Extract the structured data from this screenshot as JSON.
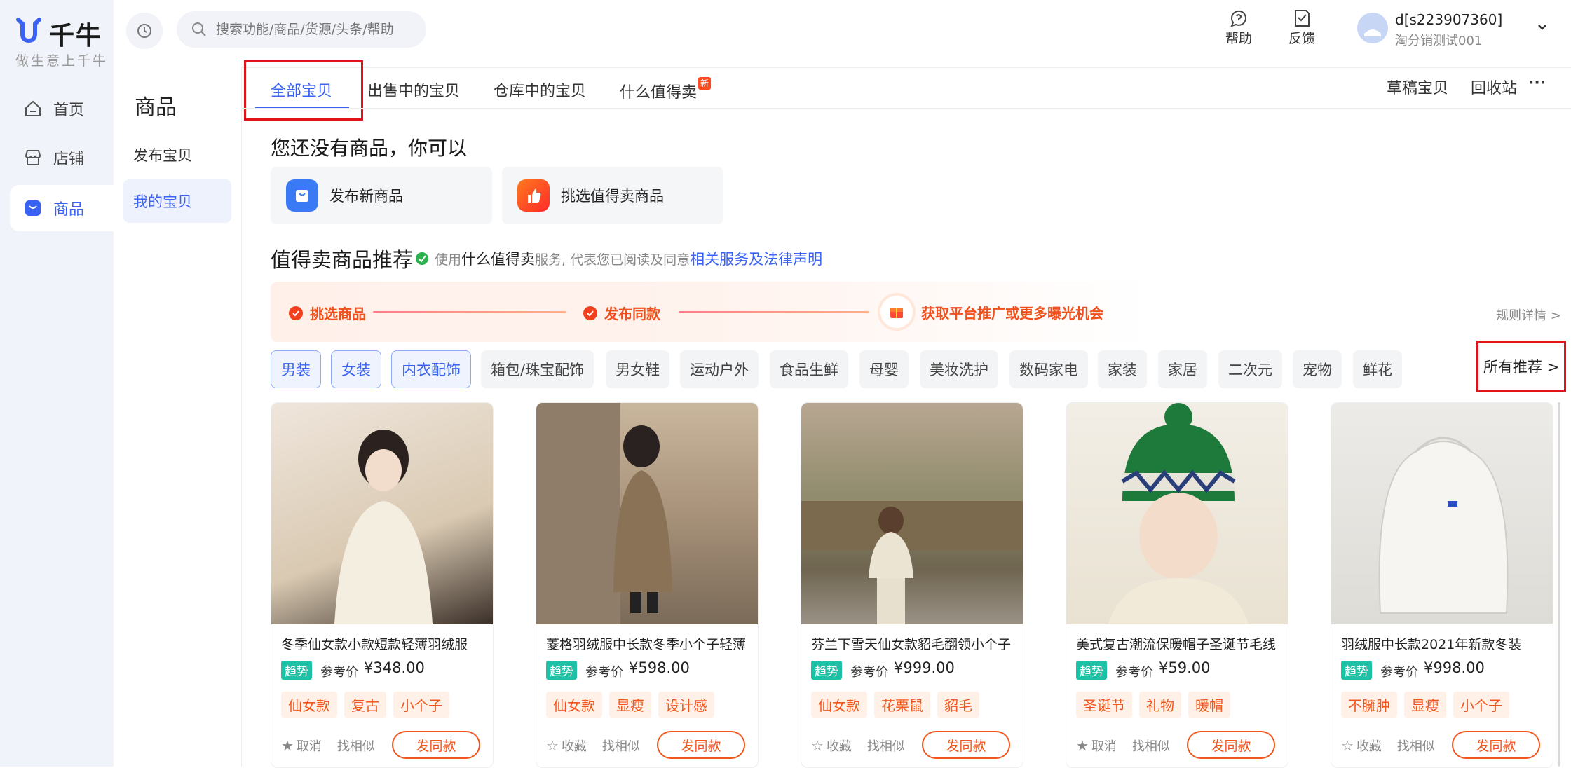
{
  "brand": {
    "name": "千牛",
    "slogan": "做生意上千牛"
  },
  "rail": [
    {
      "label": "首页",
      "icon": "home-icon"
    },
    {
      "label": "店铺",
      "icon": "store-icon"
    },
    {
      "label": "商品",
      "icon": "goods-icon",
      "active": true
    }
  ],
  "subnav": {
    "title": "商品",
    "items": [
      {
        "label": "发布宝贝"
      },
      {
        "label": "我的宝贝",
        "active": true
      }
    ]
  },
  "search": {
    "placeholder": "搜索功能/商品/货源/头条/帮助"
  },
  "tools": {
    "help": "帮助",
    "feedback": "反馈"
  },
  "user": {
    "name": "d[s223907360]",
    "sub": "淘分销测试001"
  },
  "tabs": [
    {
      "label": "全部宝贝",
      "active": true
    },
    {
      "label": "出售中的宝贝"
    },
    {
      "label": "仓库中的宝贝"
    },
    {
      "label": "什么值得卖",
      "badge": "新"
    }
  ],
  "tabs_right": {
    "draft": "草稿宝贝",
    "recycle": "回收站",
    "more": "···"
  },
  "empty": {
    "title": "您还没有商品，你可以",
    "actions": [
      {
        "label": "发布新商品"
      },
      {
        "label": "挑选值得卖商品"
      }
    ]
  },
  "section": {
    "title": "值得卖商品推荐",
    "note_prefix": "使用",
    "note_highlight": "什么值得卖",
    "note_mid": "服务, 代表您已阅读及同意",
    "note_link": "相关服务及法律声明",
    "steps": [
      "挑选商品",
      "发布同款",
      "获取平台推广或更多曝光机会"
    ],
    "rule_link": "规则详情 >"
  },
  "categories": [
    {
      "label": "男装",
      "selected": true
    },
    {
      "label": "女装",
      "selected": true
    },
    {
      "label": "内衣配饰",
      "selected": true
    },
    {
      "label": "箱包/珠宝配饰"
    },
    {
      "label": "男女鞋"
    },
    {
      "label": "运动户外"
    },
    {
      "label": "食品生鲜"
    },
    {
      "label": "母婴"
    },
    {
      "label": "美妆洗护"
    },
    {
      "label": "数码家电"
    },
    {
      "label": "家装"
    },
    {
      "label": "家居"
    },
    {
      "label": "二次元"
    },
    {
      "label": "宠物"
    },
    {
      "label": "鲜花"
    }
  ],
  "all_recommend": "所有推荐 >",
  "products": [
    {
      "name": "冬季仙女款小款短款轻薄羽绒服",
      "trend": "趋势",
      "ref": "参考价",
      "price": "¥348.00",
      "tags": [
        "仙女款",
        "复古",
        "小个子"
      ],
      "fav": "取消",
      "similar": "找相似",
      "same": "发同款",
      "colors": [
        "#efe6dc",
        "#d9c9b2"
      ]
    },
    {
      "name": "菱格羽绒服中长款冬季小个子轻薄",
      "trend": "趋势",
      "ref": "参考价",
      "price": "¥598.00",
      "tags": [
        "仙女款",
        "显瘦",
        "设计感"
      ],
      "fav": "收藏",
      "similar": "找相似",
      "same": "发同款",
      "colors": [
        "#c9b79d",
        "#8a7256"
      ]
    },
    {
      "name": "芬兰下雪天仙女款貂毛翻领小个子",
      "trend": "趋势",
      "ref": "参考价",
      "price": "¥999.00",
      "tags": [
        "仙女款",
        "花栗鼠",
        "貂毛"
      ],
      "fav": "收藏",
      "similar": "找相似",
      "same": "发同款",
      "colors": [
        "#b8a792",
        "#6f6550"
      ]
    },
    {
      "name": "美式复古潮流保暖帽子圣诞节毛线",
      "trend": "趋势",
      "ref": "参考价",
      "price": "¥59.00",
      "tags": [
        "圣诞节",
        "礼物",
        "暖帽"
      ],
      "fav": "取消",
      "similar": "找相似",
      "same": "发同款",
      "colors": [
        "#e9e2d2",
        "#1e7a3a"
      ]
    },
    {
      "name": "羽绒服中长款2021年新款冬装",
      "trend": "趋势",
      "ref": "参考价",
      "price": "¥998.00",
      "tags": [
        "不臃肿",
        "显瘦",
        "小个子"
      ],
      "fav": "收藏",
      "similar": "找相似",
      "same": "发同款",
      "colors": [
        "#ecebe8",
        "#cfcdc8"
      ]
    }
  ],
  "colors": {
    "accent": "#3a63f3",
    "orange": "#f0561e",
    "trend": "#1dc2a6",
    "highlight_box": "#e1121a"
  }
}
